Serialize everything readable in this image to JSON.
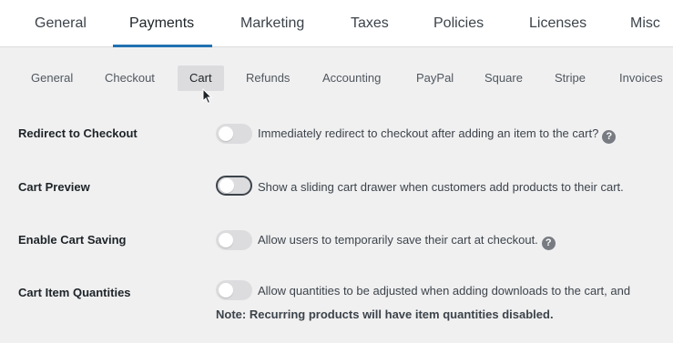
{
  "main_tabs": [
    {
      "label": "General"
    },
    {
      "label": "Payments",
      "active": true
    },
    {
      "label": "Marketing"
    },
    {
      "label": "Taxes"
    },
    {
      "label": "Policies"
    },
    {
      "label": "Licenses"
    },
    {
      "label": "Misc"
    }
  ],
  "sub_tabs": [
    {
      "label": "General"
    },
    {
      "label": "Checkout"
    },
    {
      "label": "Cart",
      "active": true
    },
    {
      "label": "Refunds"
    },
    {
      "label": "Accounting"
    },
    {
      "label": "PayPal"
    },
    {
      "label": "Square"
    },
    {
      "label": "Stripe"
    },
    {
      "label": "Invoices"
    }
  ],
  "settings": [
    {
      "label": "Redirect to Checkout",
      "enabled": false,
      "description": "Immediately redirect to checkout after adding an item to the cart?",
      "help_icon": "question-circle-icon"
    },
    {
      "label": "Cart Preview",
      "enabled": false,
      "focused": true,
      "description": "Show a sliding cart drawer when customers add products to their cart."
    },
    {
      "label": "Enable Cart Saving",
      "enabled": false,
      "description": "Allow users to temporarily save their cart at checkout.",
      "help_icon": "question-circle-icon"
    },
    {
      "label": "Cart Item Quantities",
      "enabled": false,
      "description": "Allow quantities to be adjusted when adding downloads to the cart, and",
      "note": "Note: Recurring products will have item quantities disabled."
    }
  ],
  "help_glyph": "?",
  "colors": {
    "accent": "#2271b1",
    "toggle_off": "#dcdcde",
    "page_bg": "#f0f0f1",
    "help_icon": "#787c82"
  }
}
